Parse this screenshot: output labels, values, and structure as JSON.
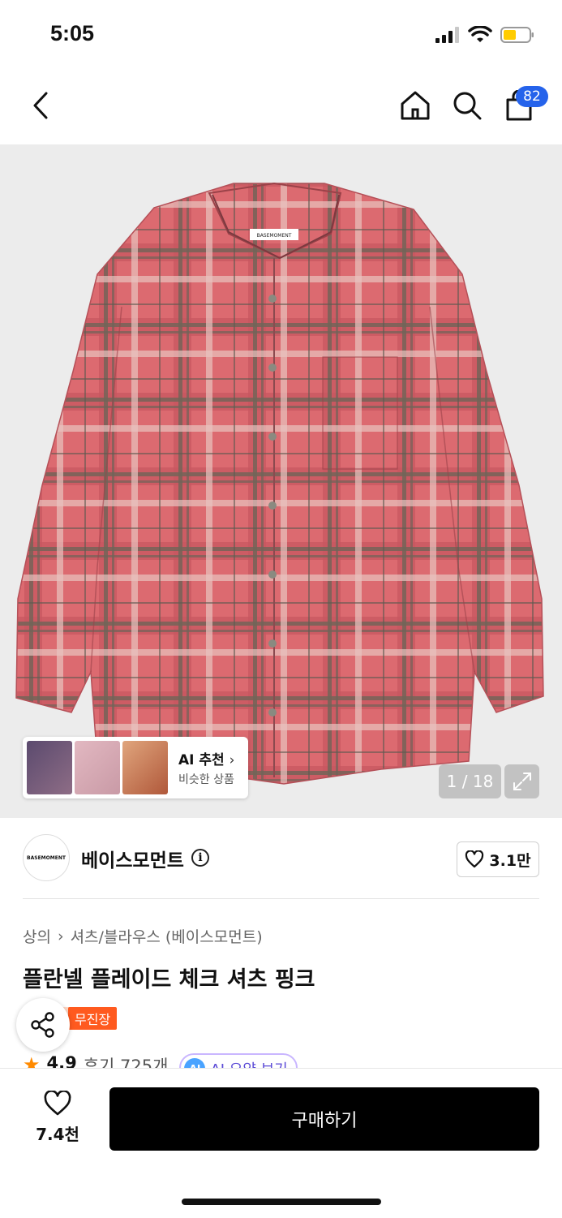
{
  "status_bar": {
    "time": "5:05",
    "battery_color": "#ffcc00"
  },
  "nav": {
    "back_icon": "chevron-left-icon",
    "home_icon": "home-icon",
    "search_icon": "search-icon",
    "cart_icon": "shopping-bag-icon",
    "cart_count": "82"
  },
  "product_image": {
    "brand_tag": "BASEMOMENT",
    "ai_reco": {
      "title": "AI 추천",
      "subtitle": "비슷한 상품"
    },
    "pager": "1 / 18"
  },
  "brand": {
    "logo_text": "BASEMOMENT",
    "name": "베이스모먼트",
    "likes": "3.1만"
  },
  "breadcrumb": {
    "category": "상의",
    "subcategory": "셔츠/블라우스 (베이스모먼트)"
  },
  "product": {
    "title": "플란넬 플레이드 체크 셔츠 핑크",
    "badge": "무진장",
    "rating": "4.9",
    "reviews": "후기 725개",
    "ai_summary": "AI 요약 보기",
    "ai_icon_text": "AI"
  },
  "bottom": {
    "wish_count": "7.4천",
    "buy_label": "구매하기"
  },
  "colors": {
    "accent_blue": "#2563eb",
    "badge_orange": "#ff5a1f",
    "shirt_pink": "#d9676c"
  }
}
